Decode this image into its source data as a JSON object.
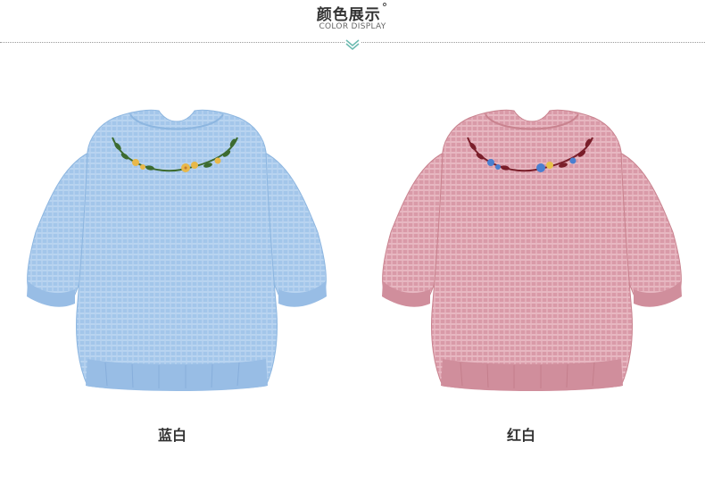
{
  "header": {
    "title": "颜色展示",
    "degree": "°",
    "subtitle": "COLOR DISPLAY"
  },
  "products": [
    {
      "label": "蓝白",
      "fill": "#a3c6ea",
      "shade": "#8db6e0",
      "line": "#b8d4f0",
      "flower": "#e8b84a",
      "leaf": "#3c6b2f"
    },
    {
      "label": "红白",
      "fill": "#d99aa8",
      "shade": "#c9838f",
      "line": "#e7b7c1",
      "flower": "#4a7fd0",
      "leaf": "#7a1e2a"
    }
  ],
  "colors": {
    "accent": "#6bbab0"
  }
}
